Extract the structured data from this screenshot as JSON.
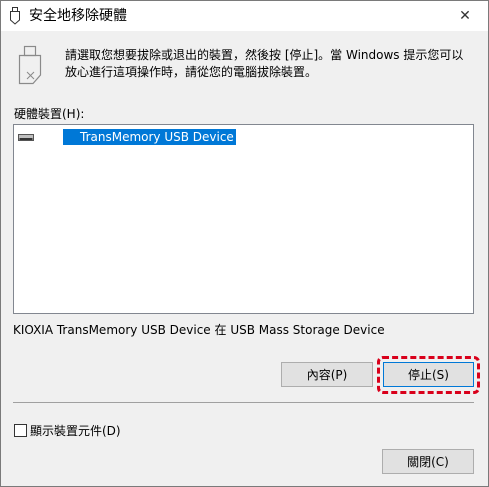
{
  "window": {
    "title": "安全地移除硬體",
    "close_glyph": "✕"
  },
  "instruction": "請選取您想要拔除或退出的裝置，然後按 [停止]。當 Windows 提示您可以放心進行這項操作時，請從您的電腦拔除裝置。",
  "device_list": {
    "label": "硬體裝置(H):",
    "items": [
      {
        "name": "TransMemory USB Device",
        "icon": "usb-drive-icon",
        "selected": true
      }
    ]
  },
  "device_description": "KIOXIA TransMemory USB Device 在 USB Mass Storage Device",
  "buttons": {
    "properties": "內容(P)",
    "stop": "停止(S)",
    "close": "關閉(C)"
  },
  "checkbox": {
    "label": "顯示裝置元件(D)",
    "checked": false
  },
  "colors": {
    "selection": "#0078d7",
    "highlight": "#d9001b",
    "window_bg": "#f0f0f0"
  }
}
